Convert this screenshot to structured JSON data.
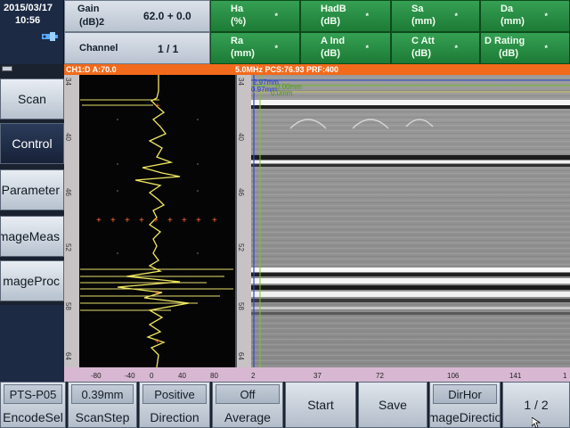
{
  "status": {
    "date": "2015/03/17",
    "time": "10:56",
    "usb_icon": "usb-icon"
  },
  "params": {
    "gain_label": "Gain",
    "gain_unit": "(dB)2",
    "gain_value": "62.0 + 0.0",
    "channel_label": "Channel",
    "channel_value": "1 / 1"
  },
  "measurements": [
    {
      "label": "Ha",
      "unit": "(%)",
      "value": "*"
    },
    {
      "label": "HadB",
      "unit": "(dB)",
      "value": "*"
    },
    {
      "label": "Sa",
      "unit": "(mm)",
      "value": "*"
    },
    {
      "label": "Da",
      "unit": "(mm)",
      "value": "*"
    },
    {
      "label": "Ra",
      "unit": "(mm)",
      "value": "*"
    },
    {
      "label": "A Ind",
      "unit": "(dB)",
      "value": "*"
    },
    {
      "label": "C Att",
      "unit": "(dB)",
      "value": "*"
    },
    {
      "label": "D Rating",
      "unit": "(dB)",
      "value": "*"
    }
  ],
  "infobar": {
    "left": "CH1:D A:70.0",
    "right": "5.0MHz PCS:76.93 PRF:400"
  },
  "nav": {
    "items": [
      {
        "label": "Scan"
      },
      {
        "label": "Control"
      },
      {
        "label": "Parameter"
      },
      {
        "label": "mageMeas"
      },
      {
        "label": "mageProc"
      }
    ]
  },
  "ascan": {
    "depth_ticks": [
      "34",
      "40",
      "46",
      "52",
      "58",
      "64"
    ],
    "x_ticks": [
      "-80",
      "-40",
      "0",
      "40",
      "80"
    ]
  },
  "bscan": {
    "depth_ticks": [
      "34",
      "40",
      "46",
      "52",
      "58",
      "64"
    ],
    "x_ticks": [
      "2",
      "37",
      "72",
      "106",
      "141",
      "1"
    ],
    "cursor_label_1": "2.97mm",
    "cursor_label_2": "0.97mm",
    "cursor_label_3": "0.00mm",
    "cursor_label_4": "0.0mm"
  },
  "toolbar": [
    {
      "top": "PTS-P05",
      "bottom": "EncodeSel"
    },
    {
      "top": "0.39mm",
      "bottom": "ScanStep"
    },
    {
      "top": "Positive",
      "bottom": "Direction"
    },
    {
      "top": "Off",
      "bottom": "Average"
    },
    {
      "single": "Start"
    },
    {
      "single": "Save"
    },
    {
      "top": "DirHor",
      "bottom": "mageDirectio"
    },
    {
      "single": "1 / 2"
    }
  ]
}
